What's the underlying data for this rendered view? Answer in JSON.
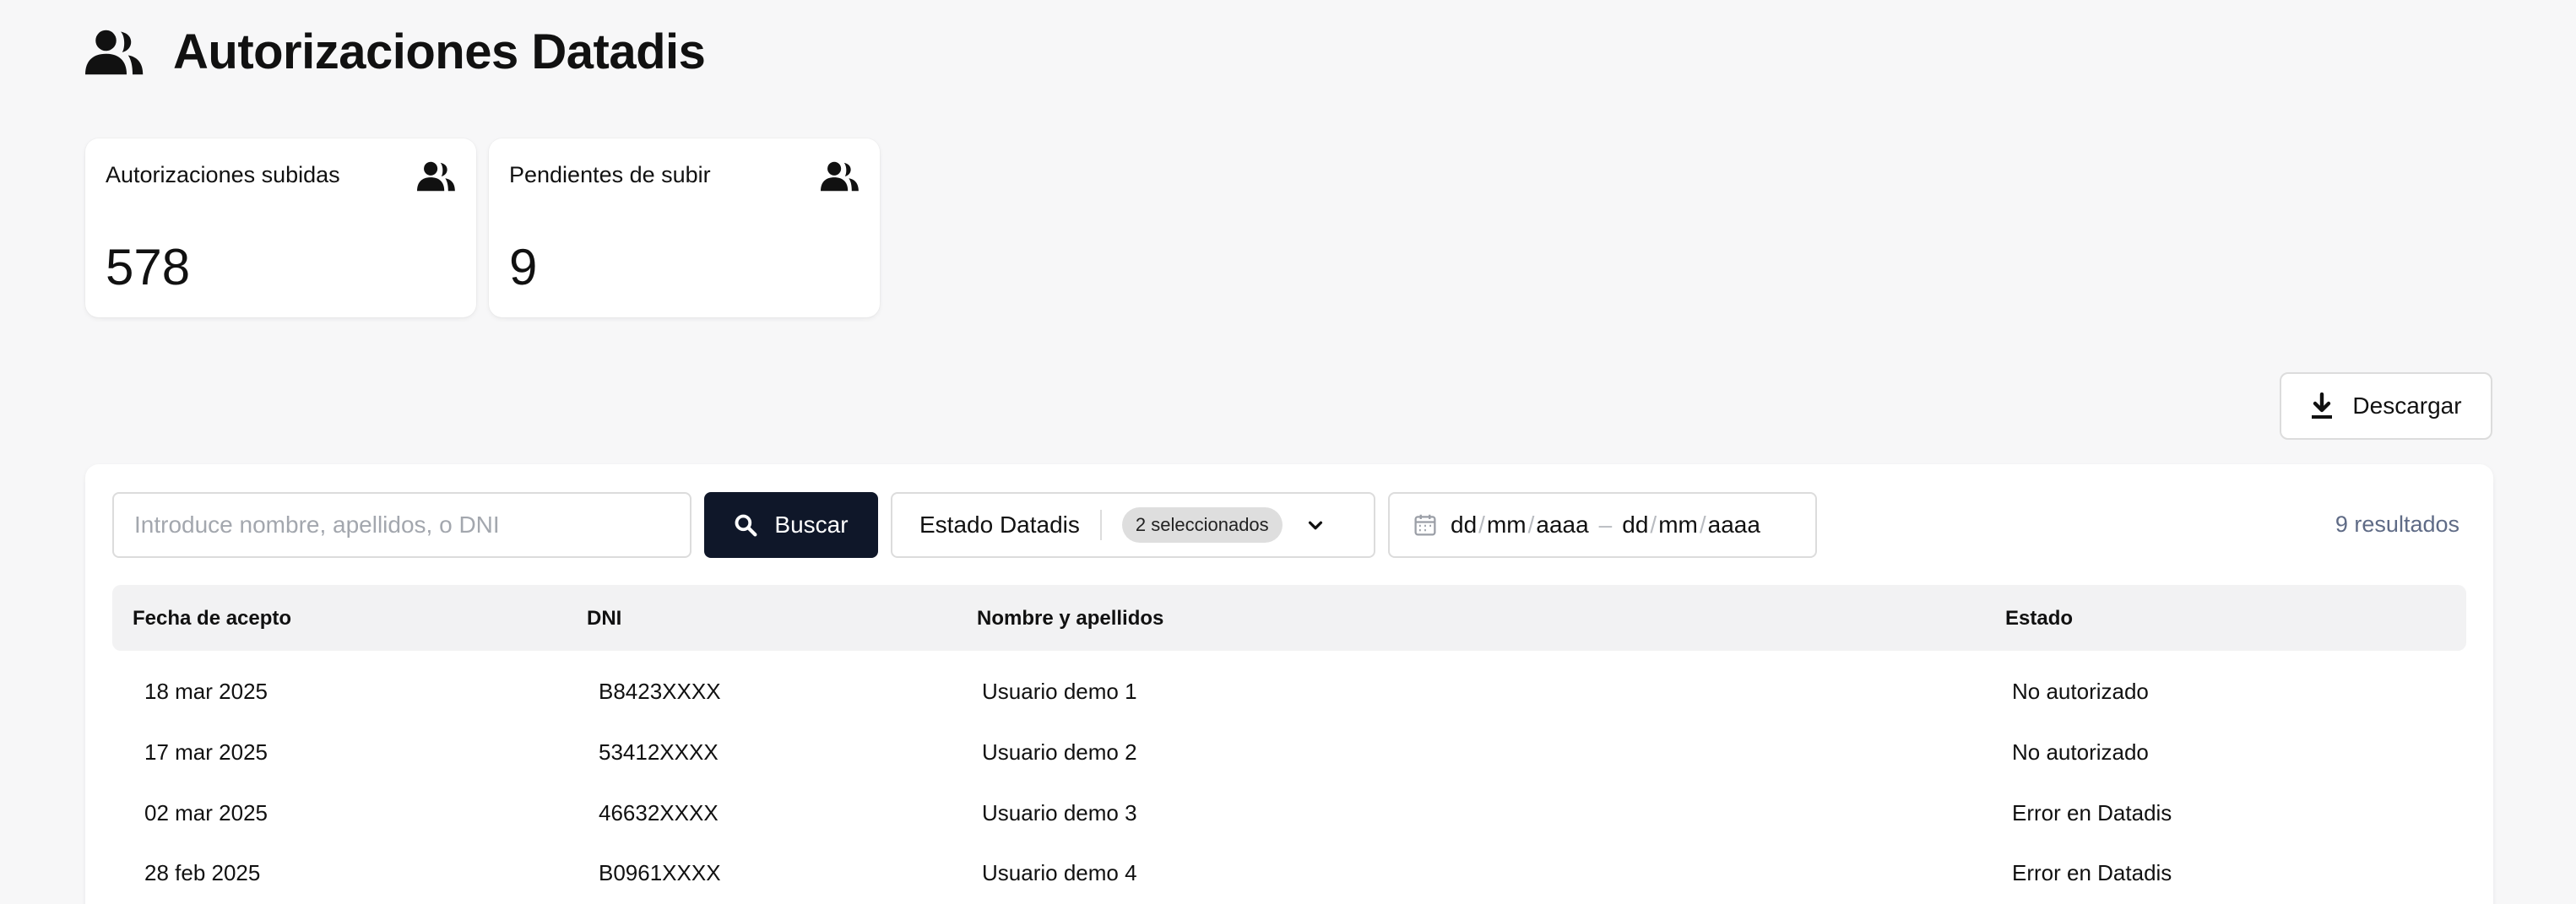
{
  "header": {
    "title": "Autorizaciones Datadis",
    "icon": "users-icon"
  },
  "stats": [
    {
      "label": "Autorizaciones subidas",
      "value": "578",
      "icon": "users-icon"
    },
    {
      "label": "Pendientes de subir",
      "value": "9",
      "icon": "users-icon"
    }
  ],
  "toolbar": {
    "download_label": "Descargar",
    "download_icon": "download-icon"
  },
  "filters": {
    "search_placeholder": "Introduce nombre, apellidos, o DNI",
    "search_value": "",
    "search_button": "Buscar",
    "status_label": "Estado Datadis",
    "status_selected": "2 seleccionados",
    "date_from": {
      "dd": "dd",
      "mm": "mm",
      "yyyy": "aaaa"
    },
    "date_to": {
      "dd": "dd",
      "mm": "mm",
      "yyyy": "aaaa"
    },
    "results": "9 resultados"
  },
  "table": {
    "columns": [
      "Fecha de acepto",
      "DNI",
      "Nombre y apellidos",
      "Estado"
    ],
    "rows": [
      {
        "date": "18 mar 2025",
        "dni": "B8423XXXX",
        "name": "Usuario demo 1",
        "status": "No autorizado"
      },
      {
        "date": "17 mar 2025",
        "dni": "53412XXXX",
        "name": "Usuario demo 2",
        "status": "No autorizado"
      },
      {
        "date": "02 mar 2025",
        "dni": "46632XXXX",
        "name": "Usuario demo 3",
        "status": "Error en Datadis"
      },
      {
        "date": "28 feb 2025",
        "dni": "B0961XXXX",
        "name": "Usuario demo 4",
        "status": "Error en Datadis"
      }
    ]
  },
  "colors": {
    "primary_button": "#0f1729",
    "results_text": "#5f6b86",
    "page_bg": "#f7f7f8"
  }
}
